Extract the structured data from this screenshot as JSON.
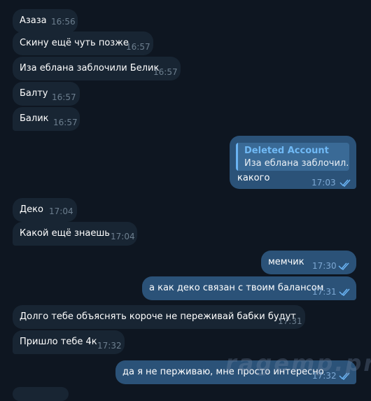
{
  "messages": [
    {
      "text": "Азаза",
      "time": "16:56"
    },
    {
      "text": "Скину ещё чуть позже",
      "time": "16:57"
    },
    {
      "text": "Иза еблана заблочили Белик",
      "time": "16:57"
    },
    {
      "text": "Балту",
      "time": "16:57"
    },
    {
      "text": "Балик",
      "time": "16:57"
    },
    {
      "reply_name": "Deleted Account",
      "reply_text": "Иза еблана заблочил...",
      "text": "какого",
      "time": "17:03"
    },
    {
      "text": "Деко",
      "time": "17:04"
    },
    {
      "text": "Какой ещё знаешь",
      "time": "17:04"
    },
    {
      "text": "мемчик",
      "time": "17:30"
    },
    {
      "text": "а как деко связан с твоим балансом",
      "time": "17:31"
    },
    {
      "text": "Долго тебе объяснять короче не переживай бабки будут",
      "time": "17:31"
    },
    {
      "text": "Пришло тебе 4к",
      "time": "17:32"
    },
    {
      "text": "да я не перживаю, мне просто интересно",
      "time": "17:32"
    }
  ],
  "watermark": "ragemp.pro",
  "colors": {
    "background": "#0e1621",
    "incoming": "#182533",
    "outgoing": "#2b5278",
    "accent": "#6ab3f3"
  },
  "icons": {
    "read_status": "double-check-icon"
  }
}
